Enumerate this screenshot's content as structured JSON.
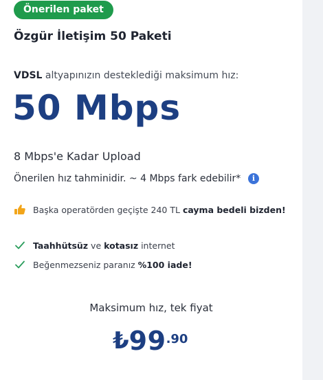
{
  "badge": "Önerilen paket",
  "package_title": "Özgür İletişim 50 Paketi",
  "infra": {
    "tech": "VDSL",
    "text": " altyapınızın desteklediği maksimum hız:"
  },
  "speed": "50 Mbps",
  "upload": "8 Mbps'e Kadar Upload",
  "estimate": "Önerilen hız tahminidir. ~ 4 Mbps fark edebilir*",
  "info_icon_glyph": "i",
  "offer": {
    "text": "Başka operatörden geçişte 240 TL ",
    "bold": "cayma bedeli bizden!"
  },
  "features": [
    {
      "b1": "Taahhütsüz",
      "t1": " ve ",
      "b2": "kotasız",
      "t2": " internet"
    },
    {
      "t1": "Beğenmezseniz paranız ",
      "b2": "%100 iade!"
    }
  ],
  "price_caption": "Maksimum hız, tek fiyat",
  "price": {
    "currency": "₺",
    "integer": "99",
    "decimal": ".90"
  },
  "colors": {
    "accent": "#1d3f82",
    "badge": "#1f9b4c",
    "check": "#2a9d5c",
    "info": "#3b73d9",
    "thumb": "#f2a51a"
  }
}
